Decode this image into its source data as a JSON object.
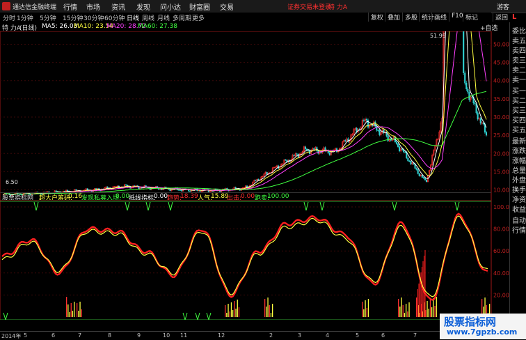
{
  "titlebar": {
    "app_name": "通达信金融终端",
    "menus": [
      "行情",
      "市场",
      "资讯",
      "发现",
      "问小达",
      "财富圈",
      "交易"
    ],
    "notice": "证券交易未登录",
    "stock_name": "特 力A",
    "user": "游客"
  },
  "periods": [
    "分时",
    "1分钟",
    "5分钟",
    "15分钟",
    "30分钟",
    "60分钟",
    "日线",
    "周线",
    "月线",
    "多周期",
    "更多"
  ],
  "active_period": "日线",
  "toolbar": [
    "复权",
    "叠加",
    "多股",
    "统计",
    "画线",
    "F10",
    "标记",
    "返回"
  ],
  "right_panel": [
    "委比",
    "卖五",
    "卖四",
    "卖三",
    "卖二",
    "卖一",
    "买一",
    "买二",
    "买三",
    "买四",
    "买五",
    "最新",
    "涨跌",
    "涨幅",
    "总量",
    "外盘",
    "换手",
    "净资",
    "收益",
    "自动",
    "行情"
  ],
  "right_panel_top": "L",
  "main": {
    "title": "特 力A",
    "period_tag": "(日线)",
    "ma5": "MA5: 26.03",
    "ma10": "MA10: 23.54",
    "ma20": "MA20: 28.72",
    "ma60": "MA60: 27.38",
    "add_indicator": "+自选",
    "high_label": "51.99",
    "low_label": "6.50",
    "center_tag": "定",
    "y_labels": [
      "50.00",
      "45.00",
      "40.00",
      "35.00",
      "30.00",
      "25.00",
      "20.00",
      "15.00",
      "10.00"
    ]
  },
  "indicator": {
    "title": "股票指标网",
    "items": [
      {
        "label": "超大户筹码:",
        "value": "0.16",
        "color": "#ffff40"
      },
      {
        "label": "发现私募入场:",
        "value": "0.00",
        "color": "#40ff40"
      },
      {
        "label": "抵线指标:",
        "value": "0.00",
        "color": "#ffffff"
      },
      {
        "label": "趋势:",
        "value": "18.39",
        "color": "#ff3030"
      },
      {
        "label": "人气:",
        "value": "15.89",
        "color": "#ffff40"
      },
      {
        "label": "出击:",
        "value": "0.00",
        "color": "#ff3030"
      },
      {
        "label": "跑卖:",
        "value": "100.00",
        "color": "#40ff40"
      }
    ],
    "y_labels": [
      "100.0",
      "80.00",
      "60.00",
      "40.00",
      "20.00"
    ]
  },
  "xaxis": {
    "labels": [
      "2014年",
      "5",
      "6",
      "7",
      "8",
      "9",
      "10",
      "11",
      "12",
      "2",
      "3",
      "4",
      "5",
      "6",
      "7",
      "8",
      "9"
    ]
  },
  "watermark": {
    "line1": "股票指标网",
    "line2": "www.7gpzb.com"
  },
  "colors": {
    "background": "#000000",
    "red": "#ff3030",
    "yellow": "#ffff40",
    "green": "#40ff40",
    "magenta": "#ff40ff"
  },
  "chart_data": [
    {
      "type": "candlestick",
      "title": "特 力A (日线)",
      "ylim": [
        8,
        52
      ],
      "x": [
        "2014-05",
        "2014-06",
        "2014-07",
        "2014-08",
        "2014-09",
        "2014-10",
        "2014-11",
        "2014-12",
        "2015-01",
        "2015-02",
        "2015-03",
        "2015-04",
        "2015-05",
        "2015-06",
        "2015-07",
        "2015-08",
        "2015-09"
      ],
      "close": [
        8.8,
        9.0,
        9.5,
        10.0,
        11.0,
        10.5,
        10.0,
        9.8,
        10.5,
        16.0,
        21.0,
        20.5,
        29.0,
        23.0,
        12.0,
        45.0,
        25.0
      ],
      "annotations": [
        {
          "label": "51.99"
        },
        {
          "label": "6.50"
        }
      ]
    },
    {
      "type": "line",
      "title": "股票指标网",
      "ylim": [
        0,
        100
      ],
      "series": [
        {
          "name": "趋势",
          "values": [
            55,
            70,
            40,
            80,
            78,
            60,
            38,
            80,
            20,
            60,
            85,
            90,
            75,
            30,
            85,
            15,
            92,
            40
          ]
        },
        {
          "name": "人气",
          "values": [
            52,
            68,
            42,
            78,
            76,
            58,
            40,
            78,
            22,
            58,
            82,
            88,
            72,
            32,
            82,
            18,
            90,
            42
          ]
        }
      ]
    }
  ]
}
